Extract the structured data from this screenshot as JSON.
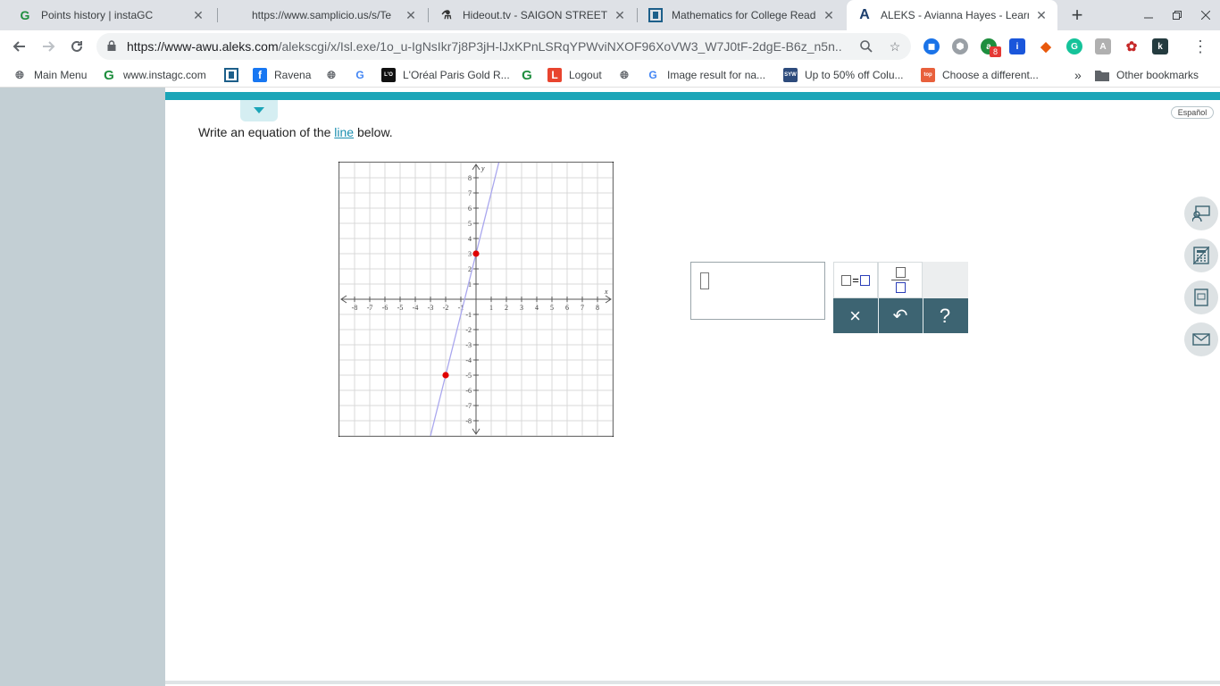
{
  "browser": {
    "tabs": [
      {
        "title": "Points history | instaGC",
        "icon": "instagc-g-icon",
        "active": false
      },
      {
        "title": "https://www.samplicio.us/s/Te",
        "icon": "",
        "active": false
      },
      {
        "title": "Hideout.tv - SAIGON STREET FO",
        "icon": "hideout-icon",
        "active": false
      },
      {
        "title": "Mathematics for College Readin",
        "icon": "mcgraw-icon",
        "active": false
      },
      {
        "title": "ALEKS - Avianna Hayes - Learn",
        "icon": "aleks-a-icon",
        "active": true
      }
    ],
    "new_tab": "+",
    "url_host": "https://www-awu.aleks.com",
    "url_path": "/alekscgi/x/Isl.exe/1o_u-IgNsIkr7j8P3jH-lJxKPnLSRqYPWviNXOF96XoVW3_W7J0tF-2dgE-B6z_n5n...",
    "extension_badge": "8",
    "bookmarks": [
      {
        "label": "Main Menu",
        "icon": "globe-icon"
      },
      {
        "label": "www.instagc.com",
        "icon": "instagc-g-icon"
      },
      {
        "label": "",
        "icon": "mcgraw-icon"
      },
      {
        "label": "Ravena",
        "icon": "facebook-icon"
      },
      {
        "label": "",
        "icon": "globe-icon"
      },
      {
        "label": "",
        "icon": "google-icon"
      },
      {
        "label": "L'Oréal Paris Gold R...",
        "icon": "loreal-icon"
      },
      {
        "label": "",
        "icon": "instagc-g-icon"
      },
      {
        "label": "Logout",
        "icon": "logout-icon"
      },
      {
        "label": "",
        "icon": "globe-icon"
      },
      {
        "label": "Image result for na...",
        "icon": "google-icon"
      },
      {
        "label": "Up to 50% off Colu...",
        "icon": "syw-icon"
      },
      {
        "label": "Choose a different...",
        "icon": "top-icon"
      }
    ],
    "bookmarks_overflow": "»",
    "other_bookmarks": "Other bookmarks"
  },
  "page": {
    "language_toggle": "Español",
    "question_prefix": "Write an equation of the ",
    "question_link": "line",
    "question_suffix": " below.",
    "answer_value": "",
    "keypad": {
      "clear": "×",
      "undo": "↶",
      "help": "?"
    }
  },
  "graph": {
    "type": "line",
    "x_label": "x",
    "y_label": "y",
    "xlim": [
      -9,
      9
    ],
    "ylim": [
      -9,
      9
    ],
    "x_ticks": [
      -8,
      -7,
      -6,
      -5,
      -4,
      -3,
      -2,
      -1,
      1,
      2,
      3,
      4,
      5,
      6,
      7,
      8
    ],
    "y_ticks": [
      -8,
      -7,
      -6,
      -5,
      -4,
      -3,
      -2,
      -1,
      1,
      2,
      3,
      4,
      5,
      6,
      7,
      8
    ],
    "grid": true,
    "line_color": "#a9a6ee",
    "point_color": "#e00000",
    "points": [
      {
        "x": 0,
        "y": 3
      },
      {
        "x": -2,
        "y": -5
      }
    ]
  },
  "colors": {
    "accent": "#1ba5b8",
    "keypad_dark": "#3d6472",
    "sidebar": "#c3cfd4"
  }
}
